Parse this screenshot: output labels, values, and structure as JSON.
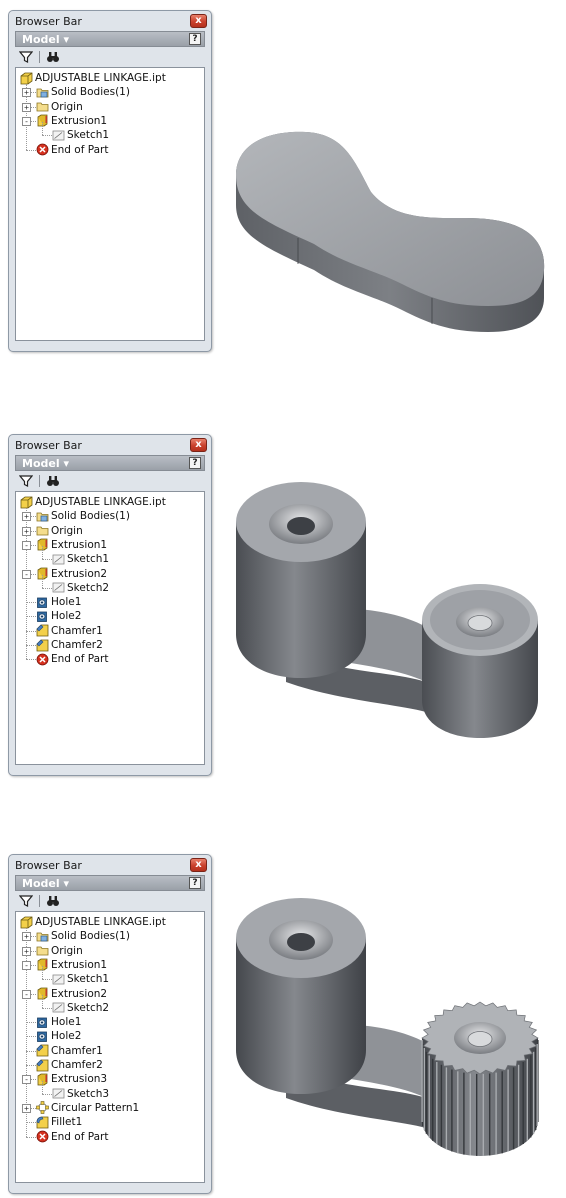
{
  "colors": {
    "panel_bg": "#dfe4ea",
    "model_header": "#a9aeb5",
    "close_red": "#c9412c",
    "part_body": "#7d8085",
    "part_top": "#a3a6ab"
  },
  "panels": [
    {
      "title": "Browser Bar",
      "close_label": "x",
      "model_label": "Model ▾",
      "help_label": "?",
      "tools": [
        "filter-icon",
        "find-icon"
      ],
      "root": "ADJUSTABLE LINKAGE.ipt",
      "items": [
        {
          "label": "Solid Bodies(1)",
          "icon": "solid-bodies-icon",
          "level": 1,
          "expander": "+"
        },
        {
          "label": "Origin",
          "icon": "folder-icon",
          "level": 1,
          "expander": "+"
        },
        {
          "label": "Extrusion1",
          "icon": "extrusion-icon",
          "level": 1,
          "expander": "-"
        },
        {
          "label": "Sketch1",
          "icon": "sketch-icon",
          "level": 2,
          "expander": ""
        },
        {
          "label": "End of Part",
          "icon": "end-of-part-icon",
          "level": 1,
          "expander": ""
        }
      ]
    },
    {
      "title": "Browser Bar",
      "close_label": "x",
      "model_label": "Model ▾",
      "help_label": "?",
      "tools": [
        "filter-icon",
        "find-icon"
      ],
      "root": "ADJUSTABLE LINKAGE.ipt",
      "items": [
        {
          "label": "Solid Bodies(1)",
          "icon": "solid-bodies-icon",
          "level": 1,
          "expander": "+"
        },
        {
          "label": "Origin",
          "icon": "folder-icon",
          "level": 1,
          "expander": "+"
        },
        {
          "label": "Extrusion1",
          "icon": "extrusion-icon",
          "level": 1,
          "expander": "-"
        },
        {
          "label": "Sketch1",
          "icon": "sketch-icon",
          "level": 2,
          "expander": ""
        },
        {
          "label": "Extrusion2",
          "icon": "extrusion-icon",
          "level": 1,
          "expander": "-"
        },
        {
          "label": "Sketch2",
          "icon": "sketch-icon",
          "level": 2,
          "expander": ""
        },
        {
          "label": "Hole1",
          "icon": "hole-icon",
          "level": 1,
          "expander": ""
        },
        {
          "label": "Hole2",
          "icon": "hole-icon",
          "level": 1,
          "expander": ""
        },
        {
          "label": "Chamfer1",
          "icon": "chamfer-icon",
          "level": 1,
          "expander": ""
        },
        {
          "label": "Chamfer2",
          "icon": "chamfer-icon",
          "level": 1,
          "expander": ""
        },
        {
          "label": "End of Part",
          "icon": "end-of-part-icon",
          "level": 1,
          "expander": ""
        }
      ]
    },
    {
      "title": "Browser Bar",
      "close_label": "x",
      "model_label": "Model ▾",
      "help_label": "?",
      "tools": [
        "filter-icon",
        "find-icon"
      ],
      "root": "ADJUSTABLE LINKAGE.ipt",
      "items": [
        {
          "label": "Solid Bodies(1)",
          "icon": "solid-bodies-icon",
          "level": 1,
          "expander": "+"
        },
        {
          "label": "Origin",
          "icon": "folder-icon",
          "level": 1,
          "expander": "+"
        },
        {
          "label": "Extrusion1",
          "icon": "extrusion-icon",
          "level": 1,
          "expander": "-"
        },
        {
          "label": "Sketch1",
          "icon": "sketch-icon",
          "level": 2,
          "expander": ""
        },
        {
          "label": "Extrusion2",
          "icon": "extrusion-icon",
          "level": 1,
          "expander": "-"
        },
        {
          "label": "Sketch2",
          "icon": "sketch-icon",
          "level": 2,
          "expander": ""
        },
        {
          "label": "Hole1",
          "icon": "hole-icon",
          "level": 1,
          "expander": ""
        },
        {
          "label": "Hole2",
          "icon": "hole-icon",
          "level": 1,
          "expander": ""
        },
        {
          "label": "Chamfer1",
          "icon": "chamfer-icon",
          "level": 1,
          "expander": ""
        },
        {
          "label": "Chamfer2",
          "icon": "chamfer-icon",
          "level": 1,
          "expander": ""
        },
        {
          "label": "Extrusion3",
          "icon": "extrusion-icon",
          "level": 1,
          "expander": "-"
        },
        {
          "label": "Sketch3",
          "icon": "sketch-icon",
          "level": 2,
          "expander": ""
        },
        {
          "label": "Circular Pattern1",
          "icon": "circular-pattern-icon",
          "level": 1,
          "expander": "+"
        },
        {
          "label": "Fillet1",
          "icon": "fillet-icon",
          "level": 1,
          "expander": ""
        },
        {
          "label": "End of Part",
          "icon": "end-of-part-icon",
          "level": 1,
          "expander": ""
        }
      ]
    }
  ]
}
